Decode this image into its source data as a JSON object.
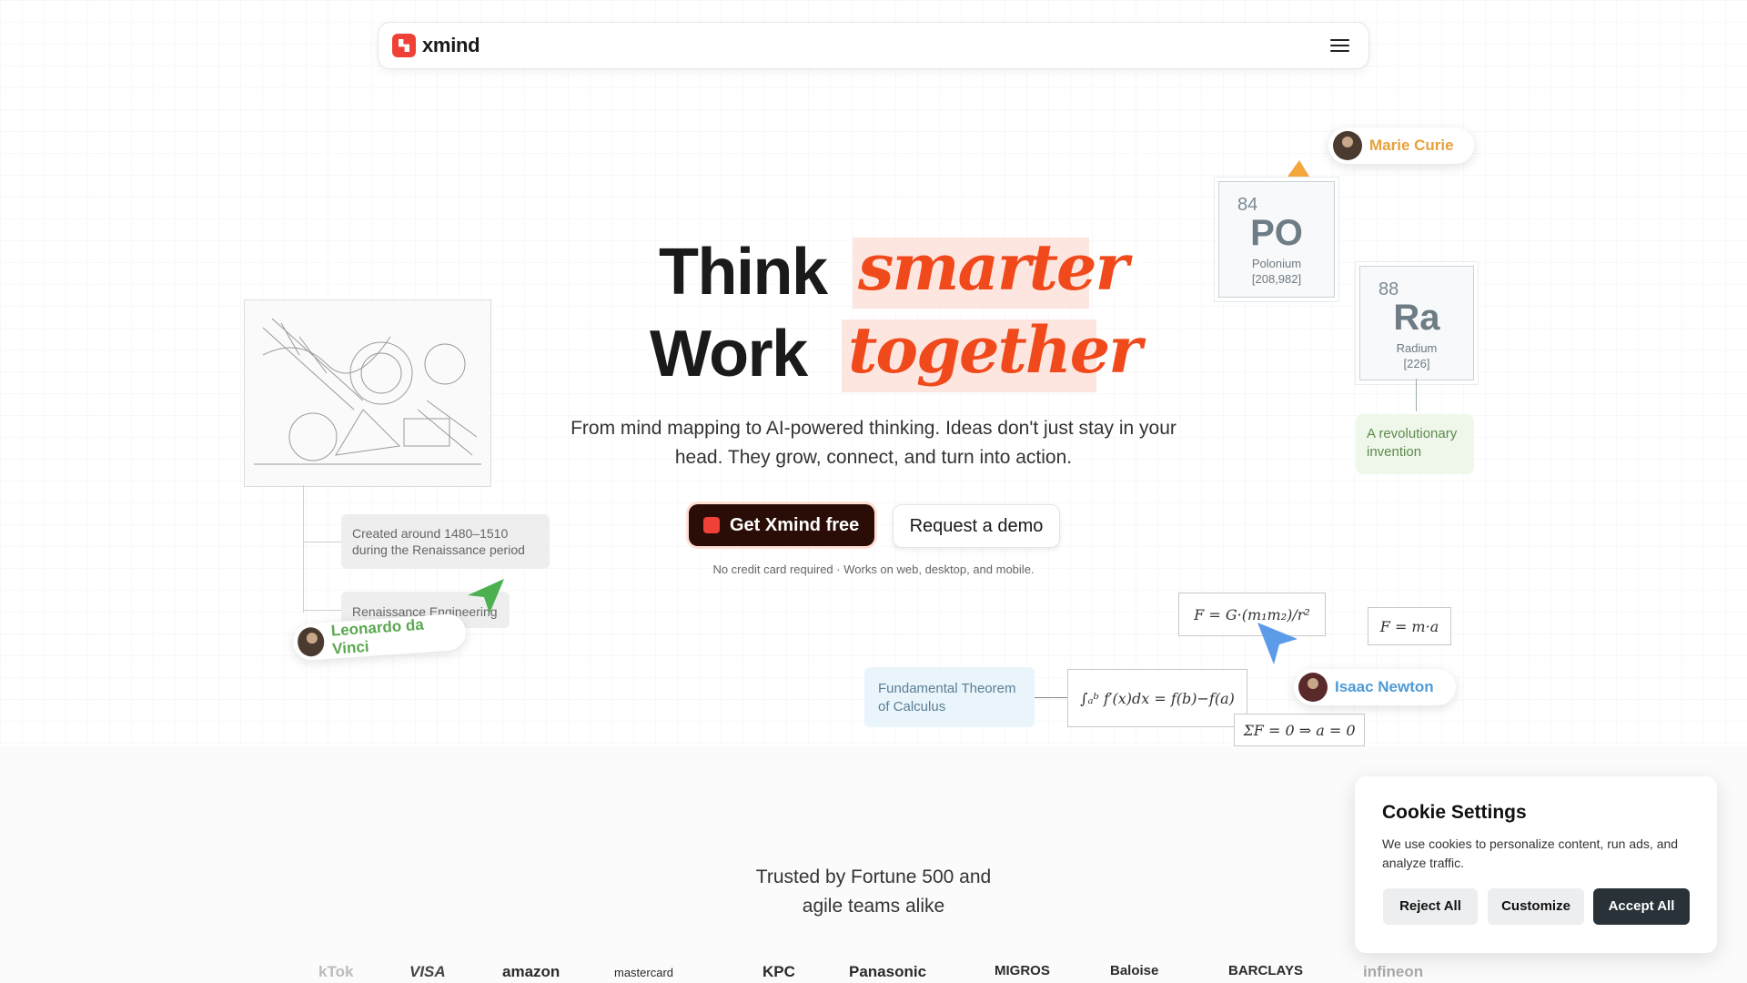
{
  "nav": {
    "brand": "xmind"
  },
  "hero": {
    "word_think": "Think",
    "word_smarter": "smarter",
    "word_work": "Work",
    "word_together": "together",
    "subtitle": "From mind mapping to AI-powered thinking. Ideas don't just stay in your head. They grow, connect, and turn into action.",
    "primary_cta": "Get Xmind free",
    "secondary_cta": "Request a demo",
    "note": "No credit card required · Works on web, desktop, and mobile."
  },
  "left_map": {
    "card1": "Created around 1480–1510 during the Renaissance period",
    "card2": "Renaissance Engineering",
    "person": "Leonardo da Vinci"
  },
  "right_map": {
    "person": "Marie Curie",
    "polonium": {
      "number": "84",
      "symbol": "PO",
      "name": "Polonium",
      "mass": "[208,982]"
    },
    "radium": {
      "number": "88",
      "symbol": "Ra",
      "name": "Radium",
      "mass": "[226]"
    },
    "invention_card": "A revolutionary invention"
  },
  "formula_map": {
    "newton_gravity": "F = G·(m₁m₂)/r²",
    "newton_second": "F = m·a",
    "calculus": "∫ₐᵇ f′(x)dx = f(b)−f(a)",
    "equilibrium": "ΣF = 0 ⇒ a = 0",
    "calculus_card": "Fundamental Theorem of Calculus",
    "person": "Isaac Newton"
  },
  "trusted": {
    "line1": "Trusted by Fortune 500 and",
    "line2": "agile teams alike",
    "logos": [
      "kTok",
      "VISA",
      "amazon",
      "mastercard",
      "KPC",
      "Panasonic",
      "MIGROS",
      "Baloise",
      "BARCLAYS",
      "infineon"
    ]
  },
  "cookie": {
    "title": "Cookie Settings",
    "text": "We use cookies to personalize content, run ads, and analyze traffic.",
    "reject": "Reject All",
    "customize": "Customize",
    "accept": "Accept All"
  },
  "colors": {
    "accent": "#f04a1c",
    "primary_button": "#2a0d06",
    "marie_name": "#e8a13a",
    "leonardo_name": "#5aa84f",
    "newton_name": "#4e9ad6",
    "cookie_accept": "#283238"
  }
}
